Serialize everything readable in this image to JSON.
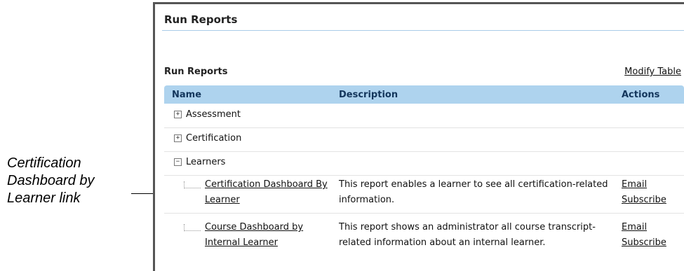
{
  "annotation": {
    "callout_text": "Certification Dashboard by Learner link"
  },
  "panel": {
    "title": "Run Reports",
    "section_label": "Run Reports",
    "modify_table_link": "Modify Table"
  },
  "table": {
    "columns": [
      "Name",
      "Description",
      "Actions"
    ],
    "groups": [
      {
        "label": "Assessment",
        "expanded": false,
        "toggle": "+"
      },
      {
        "label": "Certification",
        "expanded": false,
        "toggle": "+"
      },
      {
        "label": "Learners",
        "expanded": true,
        "toggle": "−"
      }
    ],
    "reports": [
      {
        "name": "Certification Dashboard By Learner",
        "description": "This report enables a learner to see all certification-related information.",
        "actions": [
          "Email",
          "Subscribe"
        ]
      },
      {
        "name": "Course Dashboard by Internal Learner",
        "description": "This report shows an administrator all course transcript-related information about an internal learner.",
        "actions": [
          "Email",
          "Subscribe"
        ]
      }
    ]
  },
  "colors": {
    "header_bg": "#aed3ee",
    "header_text": "#13365c",
    "title_rule": "#a9cbe8"
  }
}
